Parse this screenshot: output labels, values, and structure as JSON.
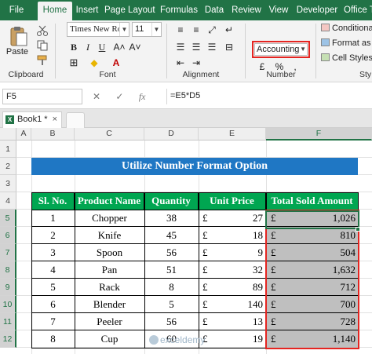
{
  "ribbon_tabs": [
    "File",
    "Home",
    "Insert",
    "Page Layout",
    "Formulas",
    "Data",
    "Review",
    "View",
    "Developer",
    "Office T"
  ],
  "active_tab": "Home",
  "clipboard": {
    "paste_label": "Paste",
    "group_label": "Clipboard"
  },
  "font": {
    "name": "Times New Ro",
    "size": "11",
    "group_label": "Font"
  },
  "alignment": {
    "group_label": "Alignment"
  },
  "number": {
    "format": "Accounting",
    "group_label": "Number",
    "currency_symbol": "£"
  },
  "styles": {
    "conditional": "Conditiona",
    "format_table": "Format as",
    "cell_styles": "Cell Styles",
    "group_label": "Sty"
  },
  "formula_bar": {
    "name_box": "F5",
    "cancel": "✕",
    "enter": "✓",
    "fx": "fx",
    "formula": "=E5*D5"
  },
  "workbook": {
    "tab_label": "Book1 *",
    "close": "×"
  },
  "grid": {
    "columns": [
      "A",
      "B",
      "C",
      "D",
      "E",
      "F"
    ],
    "rows": [
      "1",
      "2",
      "3",
      "4",
      "5",
      "6",
      "7",
      "8",
      "9",
      "10",
      "11",
      "12"
    ],
    "title": "Utilize Number Format Option",
    "headers": [
      "Sl. No.",
      "Product Name",
      "Quantity",
      "Unit Price",
      "Total Sold Amount"
    ],
    "data": [
      {
        "sl": "1",
        "product": "Chopper",
        "qty": "38",
        "price": "27",
        "total": "1,026"
      },
      {
        "sl": "2",
        "product": "Knife",
        "qty": "45",
        "price": "18",
        "total": "810"
      },
      {
        "sl": "3",
        "product": "Spoon",
        "qty": "56",
        "price": "9",
        "total": "504"
      },
      {
        "sl": "4",
        "product": "Pan",
        "qty": "51",
        "price": "32",
        "total": "1,632"
      },
      {
        "sl": "5",
        "product": "Rack",
        "qty": "8",
        "price": "89",
        "total": "712"
      },
      {
        "sl": "6",
        "product": "Blender",
        "qty": "5",
        "price": "140",
        "total": "700"
      },
      {
        "sl": "7",
        "product": "Peeler",
        "qty": "56",
        "price": "13",
        "total": "728"
      },
      {
        "sl": "8",
        "product": "Cup",
        "qty": "60",
        "price": "19",
        "total": "1,140"
      }
    ]
  },
  "watermark": "exceldemy",
  "colors": {
    "excel_green": "#217346",
    "title_blue": "#1f77c4",
    "header_green": "#00a651",
    "highlight_red": "#e52521",
    "shade_gray": "#bfbfbf"
  }
}
